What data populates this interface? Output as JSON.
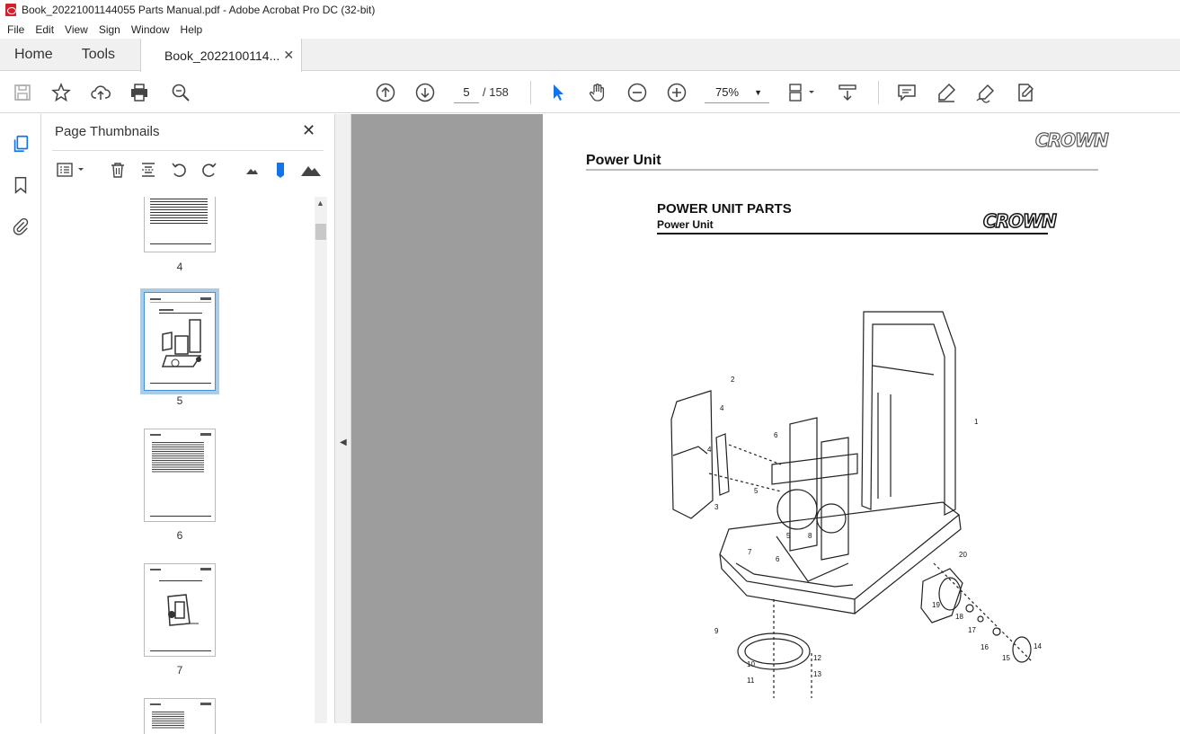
{
  "window": {
    "title": "Book_20221001144055 Parts Manual.pdf - Adobe Acrobat Pro DC (32-bit)"
  },
  "menu": [
    "File",
    "Edit",
    "View",
    "Sign",
    "Window",
    "Help"
  ],
  "tabs": {
    "home": "Home",
    "tools": "Tools",
    "document": "Book_2022100114..."
  },
  "toolbar": {
    "current_page": "5",
    "total_pages": "/ 158",
    "zoom": "75%"
  },
  "panel": {
    "title": "Page Thumbnails",
    "thumbnails": [
      {
        "label": "4",
        "selected": false
      },
      {
        "label": "5",
        "selected": true
      },
      {
        "label": "6",
        "selected": false
      },
      {
        "label": "7",
        "selected": false
      }
    ]
  },
  "page": {
    "section_title": "Power Unit",
    "logo_text": "CROWN",
    "parts_title": "POWER UNIT PARTS",
    "parts_subtitle": "Power Unit",
    "callouts": [
      "1",
      "2",
      "3",
      "4",
      "4",
      "5",
      "5",
      "6",
      "6",
      "7",
      "8",
      "9",
      "10",
      "11",
      "12",
      "13",
      "14",
      "15",
      "16",
      "17",
      "18",
      "19",
      "20"
    ]
  },
  "colors": {
    "accent": "#1473e6",
    "pdf_red": "#d4202a",
    "doc_background": "#9d9d9d",
    "selection": "#a9cde9"
  }
}
